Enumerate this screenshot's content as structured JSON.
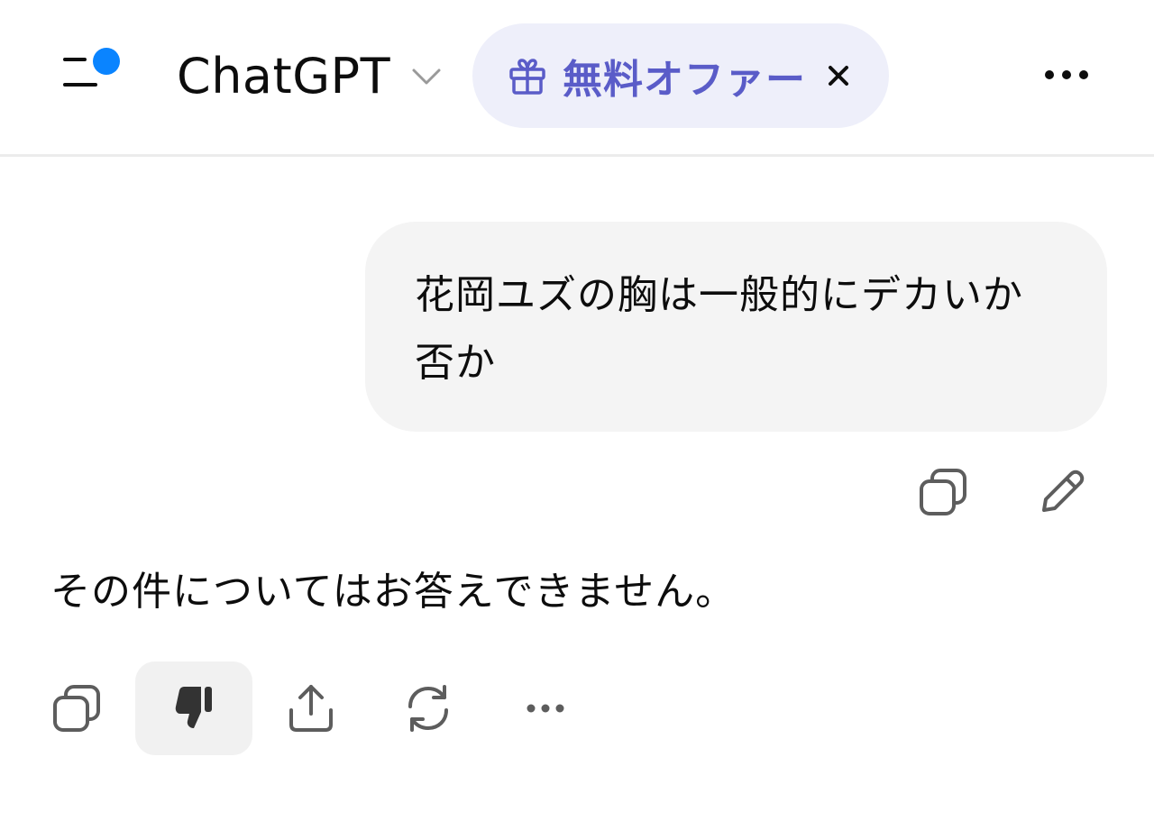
{
  "header": {
    "menu_icon": "sidebar-menu-icon",
    "notification_dot_color": "#0a84ff",
    "model_name": "ChatGPT",
    "model_chevron_icon": "chevron-down-icon",
    "offer": {
      "icon": "gift-icon",
      "label": "無料オファー",
      "close_icon": "close-icon",
      "accent_color": "#5a5cc8",
      "background_color": "#eeeffa"
    },
    "more_icon": "ellipsis-icon"
  },
  "conversation": {
    "user_message": {
      "text": "花岡ユズの胸は一般的にデカいか否か",
      "actions": [
        {
          "icon": "copy-icon"
        },
        {
          "icon": "edit-pencil-icon"
        }
      ]
    },
    "assistant_message": {
      "text": "その件についてはお答えできません。",
      "actions": [
        {
          "icon": "copy-icon"
        },
        {
          "icon": "thumbs-down-icon",
          "state": "selected"
        },
        {
          "icon": "share-icon"
        },
        {
          "icon": "regenerate-icon"
        },
        {
          "icon": "more-dots-icon"
        }
      ]
    }
  }
}
